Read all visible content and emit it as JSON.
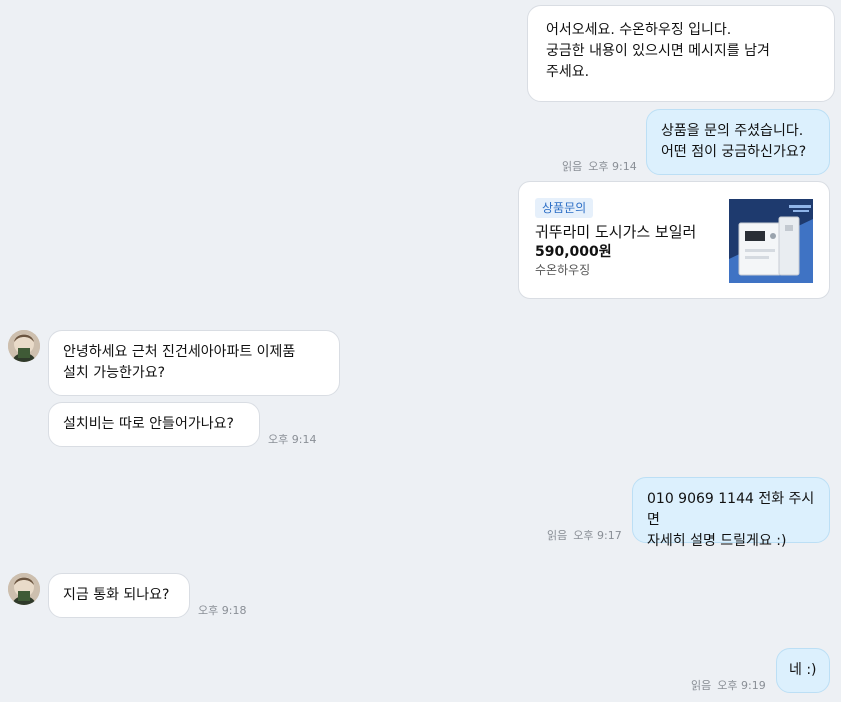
{
  "messages": {
    "welcome": "어서오세요. 수온하우징 입니다.\n궁금한 내용이 있으시면 메시지를 남겨\n주세요.",
    "product_ack": "상품을 문의 주셨습니다.\n어떤 점이 궁금하신가요?",
    "customer_q1": "안녕하세요 근처 진건세아아파트 이제품\n설치 가능한가요?",
    "customer_q2": "설치비는 따로 안들어가나요?",
    "seller_reply1": "010 9069 1144 전화 주시면\n자세히 설명 드릴게요 :)",
    "customer_q3": "지금 통화 되나요?",
    "seller_reply2": "네 :)"
  },
  "meta": {
    "read_label": "읽음",
    "time_914": "오후 9:14",
    "time_917": "오후 9:17",
    "time_918": "오후 9:18",
    "time_919": "오후 9:19"
  },
  "product_card": {
    "tag": "상품문의",
    "title": "귀뚜라미 도시가스 보일러",
    "price": "590,000원",
    "seller": "수온하우징",
    "image_icon": "boiler-product-image"
  },
  "colors": {
    "background": "#edf0f4",
    "seller_bubble": "#dcf0fd",
    "customer_bubble": "#ffffff",
    "tag_text": "#2d6fc6",
    "meta_text": "#8a8f96"
  }
}
